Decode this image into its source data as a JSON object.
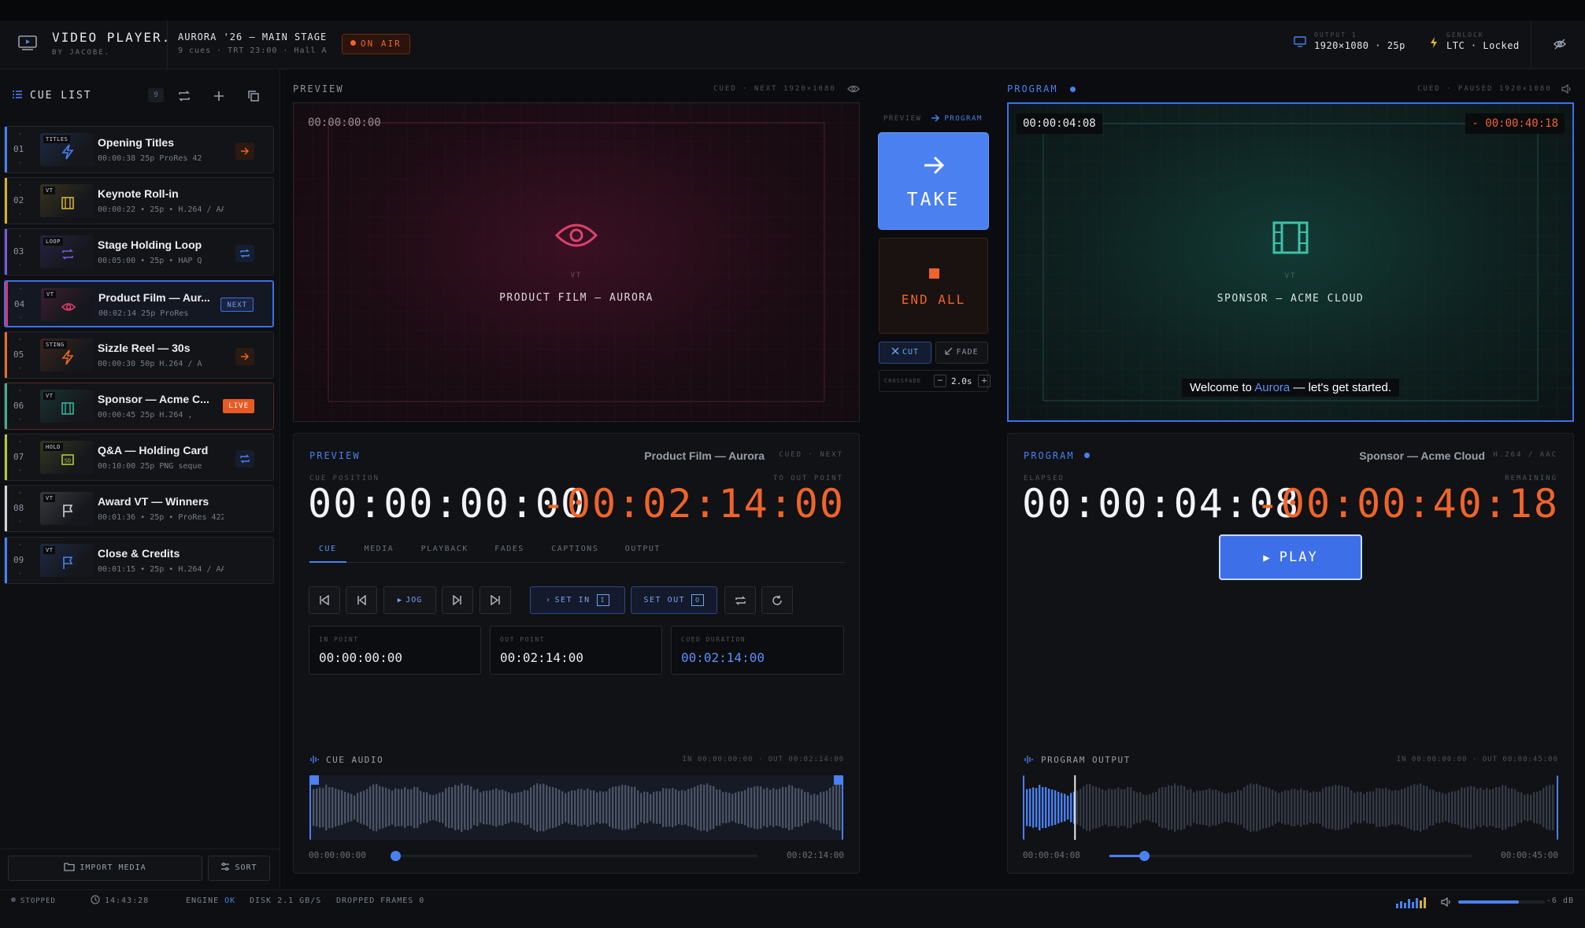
{
  "header": {
    "app_title": "VIDEO PLAYER.",
    "app_subtitle": "BY JACOBE.",
    "show_title": "AURORA '26 — MAIN STAGE",
    "show_meta": "9 cues · TRT 23:00 · Hall A",
    "on_air": "ON AIR",
    "output_label": "OUTPUT 1",
    "output_value": "1920×1080 · 25p",
    "genlock_label": "GENLOCK",
    "genlock_value": "LTC · Locked",
    "colors": {
      "accent": "#4a80f0",
      "live": "#f0642a",
      "bg": "#0b0c0f"
    }
  },
  "sidebar": {
    "title": "CUE LIST",
    "count": "9",
    "import_label": "IMPORT MEDIA",
    "sort_label": "SORT",
    "cues": [
      {
        "num": "01",
        "name": "Opening Titles",
        "meta": "00:00:38   25p   ProRes 42",
        "tag": "TITLES",
        "icon": "bolt-icon",
        "color": "#4a80f0",
        "state": "arrow"
      },
      {
        "num": "02",
        "name": "Keynote Roll-in",
        "meta": "00:00:22 • 25p • H.264 / AAC",
        "tag": "VT",
        "icon": "film-icon",
        "color": "#d6b032",
        "state": ""
      },
      {
        "num": "03",
        "name": "Stage Holding Loop",
        "meta": "00:05:00 • 25p • HAP Q",
        "tag": "LOOP",
        "icon": "loop-icon",
        "color": "#7a5ae0",
        "state": "loop"
      },
      {
        "num": "04",
        "name": "Product Film — Aur...",
        "meta": "00:02:14   25p   ProRes",
        "tag": "VT",
        "icon": "eye-icon",
        "color": "#d83a6a",
        "state": "NEXT"
      },
      {
        "num": "05",
        "name": "Sizzle Reel — 30s",
        "meta": "00:00:30   50p   H.264 / A",
        "tag": "STING",
        "icon": "bolt-icon",
        "color": "#e86a2a",
        "state": "arrow"
      },
      {
        "num": "06",
        "name": "Sponsor — Acme C...",
        "meta": "00:00:45   25p   H.264 ,",
        "tag": "VT",
        "icon": "film-icon",
        "color": "#38b09a",
        "state": "LIVE"
      },
      {
        "num": "07",
        "name": "Q&A — Holding Card",
        "meta": "00:10:00   25p   PNG seque",
        "tag": "HOLD",
        "icon": "sd-icon",
        "color": "#b0c840",
        "state": "loop"
      },
      {
        "num": "08",
        "name": "Award VT — Winners",
        "meta": "00:01:36 • 25p • ProRes 422 HQ",
        "tag": "VT",
        "icon": "flag-icon",
        "color": "#d0d3d9",
        "state": ""
      },
      {
        "num": "09",
        "name": "Close & Credits",
        "meta": "00:01:15 • 25p • H.264 / AAC",
        "tag": "VT",
        "icon": "flag-icon",
        "color": "#4a80f0",
        "state": ""
      }
    ]
  },
  "preview": {
    "label": "PREVIEW",
    "right_info": "CUED · NEXT 1920×1080",
    "timecode": "00:00:00:00",
    "type": "VT",
    "title": "PRODUCT FILM — AURORA"
  },
  "transition": {
    "direction_from": "PREVIEW",
    "direction_to": "PROGRAM",
    "take": "TAKE",
    "end_all": "END ALL",
    "cut": "CUT",
    "fade": "FADE",
    "crossfade_label": "CROSSFADE",
    "crossfade_value": "2.0s"
  },
  "program": {
    "label": "PROGRAM",
    "right_info": "CUED · PAUSED 1920×1080",
    "timecode": "00:00:04:08",
    "remaining": "- 00:00:40:18",
    "type": "VT",
    "title": "SPONSOR — ACME CLOUD",
    "caption_pre": "Welcome to ",
    "caption_hl": "Aurora",
    "caption_post": " — let's get started."
  },
  "preview_panel": {
    "label": "PREVIEW",
    "clip": "Product Film — Aurora",
    "state": "CUED · NEXT",
    "pos_label": "CUE POSITION",
    "out_label": "TO OUT POINT",
    "position": "00:00:00:00",
    "to_out": "-00:02:14:00",
    "tabs": [
      "CUE",
      "MEDIA",
      "PLAYBACK",
      "FADES",
      "CAPTIONS",
      "OUTPUT"
    ],
    "jog": "JOG",
    "set_in": "SET IN",
    "set_in_key": "I",
    "set_out": "SET OUT",
    "set_out_key": "O",
    "in_label": "IN POINT",
    "in_value": "00:00:00:00",
    "outp_label": "OUT POINT",
    "outp_value": "00:02:14:00",
    "dur_label": "CUED DURATION",
    "dur_value": "00:02:14:00",
    "audio_label": "CUE AUDIO",
    "audio_range": "IN 00:00:00:00 · OUT 00:02:14:00",
    "scrub_start": "00:00:00:00",
    "scrub_end": "00:02:14:00",
    "scrub_progress": 0
  },
  "program_panel": {
    "label": "PROGRAM",
    "clip": "Sponsor — Acme Cloud",
    "codec": "H.264 / AAC",
    "elapsed_label": "ELAPSED",
    "remaining_label": "REMAINING",
    "elapsed": "00:00:04:08",
    "remaining": "-00:00:40:18",
    "play": "PLAY",
    "audio_label": "PROGRAM OUTPUT",
    "audio_range": "IN 00:00:00:00 · OUT 00:00:45:00",
    "scrub_start": "00:00:04:08",
    "scrub_end": "00:00:45:00",
    "scrub_progress": 0.096
  },
  "status": {
    "state": "STOPPED",
    "clock": "14:43:28",
    "engine_label": "ENGINE",
    "engine_value": "OK",
    "disk": "DISK 2.1 GB/S",
    "dropped": "DROPPED FRAMES 0",
    "volume": "-6 dB",
    "volume_level": 0.7
  }
}
